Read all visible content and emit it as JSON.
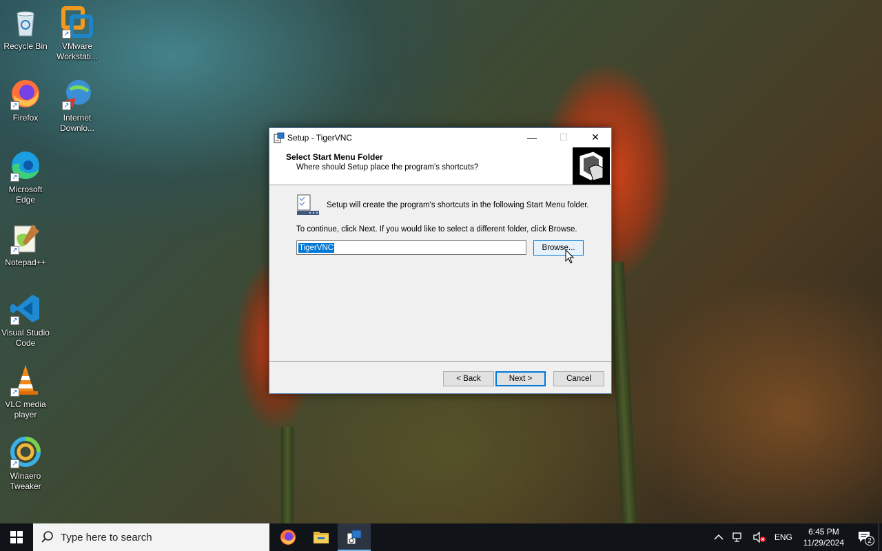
{
  "desktop": {
    "icons": [
      {
        "label": "Recycle Bin",
        "icon": "recycle-bin-icon"
      },
      {
        "label": "VMware Workstati...",
        "icon": "vmware-icon"
      },
      {
        "label": "Firefox",
        "icon": "firefox-icon"
      },
      {
        "label": "Internet Downlo...",
        "icon": "internet-download-manager-icon"
      },
      {
        "label": "Microsoft Edge",
        "icon": "edge-icon"
      },
      {
        "label": "Notepad++",
        "icon": "notepadpp-icon"
      },
      {
        "label": "Visual Studio Code",
        "icon": "vscode-icon"
      },
      {
        "label": "VLC media player",
        "icon": "vlc-icon"
      },
      {
        "label": "Winaero Tweaker",
        "icon": "winaero-icon"
      }
    ]
  },
  "dialog": {
    "title": "Setup - TigerVNC",
    "minimize": "—",
    "maximize": "☐",
    "close": "✕",
    "header_title": "Select Start Menu Folder",
    "header_subtitle": "Where should Setup place the program's shortcuts?",
    "info_line": "Setup will create the program's shortcuts in the following Start Menu folder.",
    "instruction": "To continue, click Next. If you would like to select a different folder, click Browse.",
    "folder_value": "TigerVNC",
    "browse_label": "Browse...",
    "back_label": "< Back",
    "next_label": "Next >",
    "cancel_label": "Cancel"
  },
  "taskbar": {
    "search_placeholder": "Type here to search",
    "apps": [
      "firefox-icon",
      "file-explorer-icon",
      "tigervnc-setup-icon"
    ],
    "language": "ENG",
    "time": "6:45 PM",
    "date": "11/29/2024",
    "notification_count": "2"
  },
  "colors": {
    "accent": "#0078d7",
    "taskbar": "#101418",
    "dialog_bg": "#f0f0f0"
  }
}
